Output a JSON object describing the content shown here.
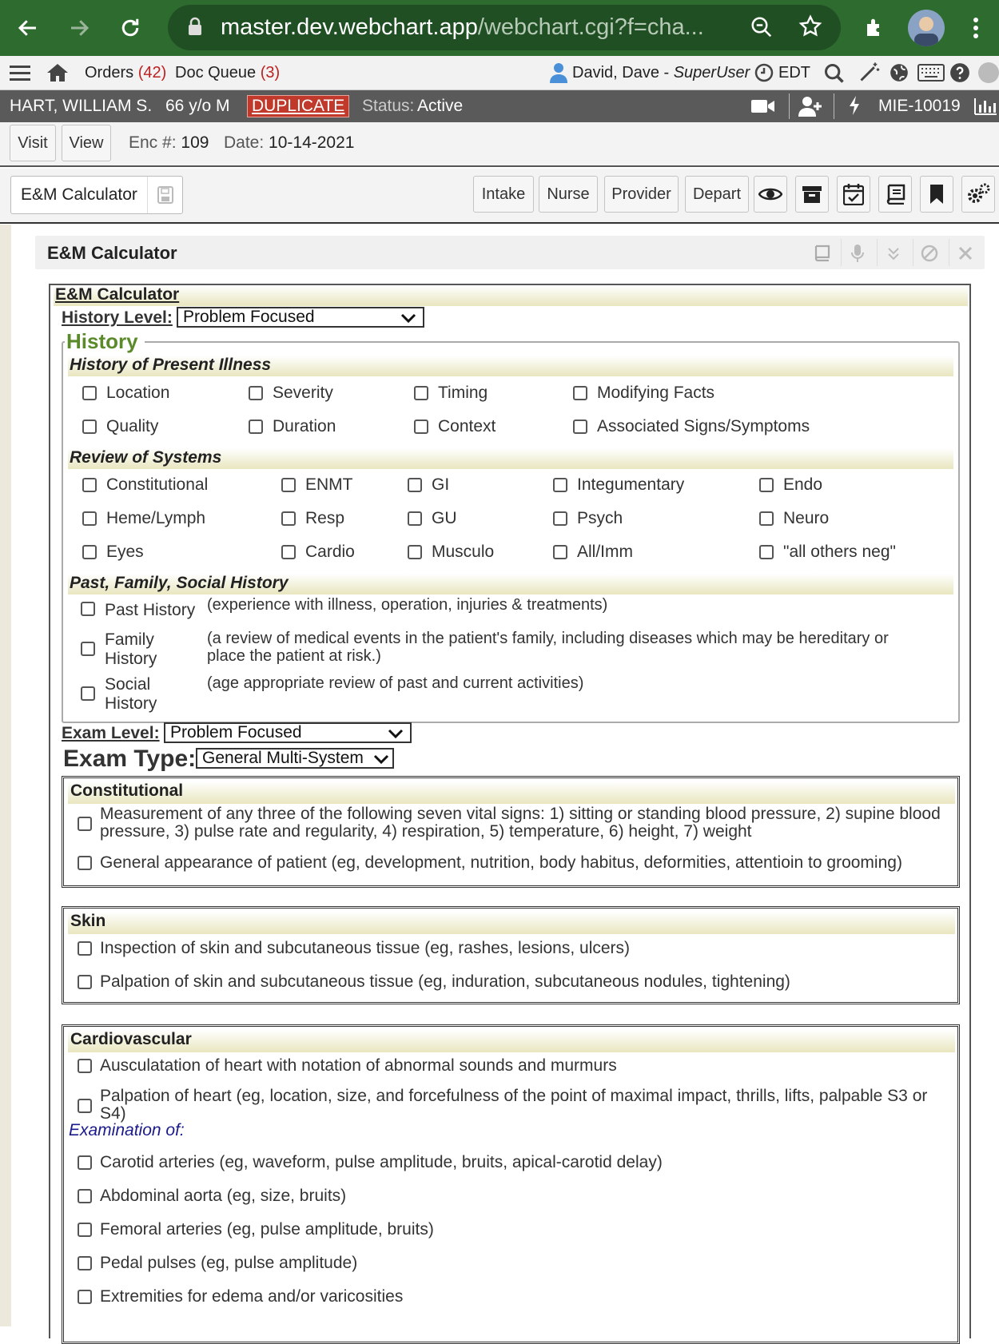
{
  "browser": {
    "url_host": "master.dev.webchart.app",
    "url_path": "/webchart.cgi?f=cha..."
  },
  "appbar": {
    "orders_label": "Orders",
    "orders_count": "(42)",
    "docqueue_label": "Doc Queue",
    "docqueue_count": "(3)",
    "user_name": "David, Dave - ",
    "user_role": "SuperUser",
    "timezone": "EDT"
  },
  "patient": {
    "name": "HART, WILLIAM S.",
    "age_sex": "66 y/o M",
    "duplicate": "DUPLICATE",
    "status_label": "Status:",
    "status_value": "Active",
    "mrn": "MIE-10019"
  },
  "encounter": {
    "visit": "Visit",
    "view": "View",
    "enc_label": "Enc #:",
    "enc_value": "109",
    "date_label": "Date:",
    "date_value": "10-14-2021"
  },
  "toolbar": {
    "tab_label": "E&M Calculator",
    "intake": "Intake",
    "nurse": "Nurse",
    "provider": "Provider",
    "depart": "Depart"
  },
  "panel": {
    "title": "E&M Calculator",
    "inner_title": "E&M Calculator",
    "history_level_label": "History Level:",
    "history_level_value": "Problem Focused",
    "history_legend": "History",
    "hpi_title": "History of Present Illness",
    "hpi_items": [
      "Location",
      "Severity",
      "Timing",
      "Modifying Facts",
      "Quality",
      "Duration",
      "Context",
      "Associated Signs/Symptoms"
    ],
    "ros_title": "Review of Systems",
    "ros_items": [
      "Constitutional",
      "ENMT",
      "GI",
      "Integumentary",
      "Endo",
      "Heme/Lymph",
      "Resp",
      "GU",
      "Psych",
      "Neuro",
      "Eyes",
      "Cardio",
      "Musculo",
      "All/Imm",
      "\"all others neg\""
    ],
    "pfsh_title": "Past, Family, Social History",
    "pfsh_past": "Past History",
    "pfsh_past_note": "(experience with illness, operation, injuries & treatments)",
    "pfsh_family_1": "Family",
    "pfsh_family_2": "History",
    "pfsh_family_note_1": "(a review of medical events in the patient's family, including diseases which may be hereditary or",
    "pfsh_family_note_2": "place the patient at risk.)",
    "pfsh_social_1": "Social",
    "pfsh_social_2": "History",
    "pfsh_social_note": "(age appropriate review of past and current activities)",
    "exam_level_label": "Exam Level:",
    "exam_level_value": "Problem Focused",
    "exam_type_label": "Exam Type:",
    "exam_type_value": "General Multi-System",
    "constitutional_title": "Constitutional",
    "constitutional_1a": "Measurement of any three of the following seven vital signs: 1) sitting or standing blood pressure, 2) supine blood",
    "constitutional_1b": "pressure, 3) pulse rate and regularity, 4) respiration, 5) temperature, 6) height, 7) weight",
    "constitutional_2": "General appearance of patient (eg, development, nutrition, body habitus, deformities, attentioin to grooming)",
    "skin_title": "Skin",
    "skin_1": "Inspection of skin and subcutaneous tissue (eg, rashes, lesions, ulcers)",
    "skin_2": "Palpation of skin and subcutaneous tissue (eg, induration, subcutaneous nodules, tightening)",
    "cardio_title": "Cardiovascular",
    "cardio_1": "Ausculatation of heart with notation of abnormal sounds and murmurs",
    "cardio_2a": "Palpation of heart (eg, location, size, and forcefulness of the point of maximal impact, thrills, lifts, palpable S3 or",
    "cardio_2b": "S4)",
    "exam_of": "Examination of:",
    "cardio_3": "Carotid arteries (eg, waveform, pulse amplitude, bruits, apical-carotid delay)",
    "cardio_4": "Abdominal aorta (eg, size, bruits)",
    "cardio_5": "Femoral arteries (eg, pulse amplitude, bruits)",
    "cardio_6": "Pedal pulses (eg, pulse amplitude)",
    "cardio_7": "Extremities for edema and/or varicosities"
  },
  "colors": {
    "browser_green": "#2e6b2f",
    "duplicate_red": "#c0392b",
    "legend_green": "#5a8a2a",
    "link_blue": "#1a1a8c"
  }
}
